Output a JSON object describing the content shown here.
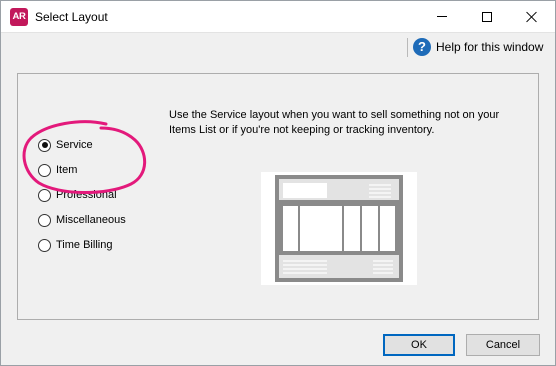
{
  "window": {
    "app_icon_text": "AR",
    "title": "Select Layout",
    "controls": [
      "minimize-icon",
      "maximize-icon",
      "close-icon"
    ]
  },
  "toolbar": {
    "help_icon": "help-icon",
    "help_label": "Help for this window"
  },
  "layout_options": [
    {
      "label": "Service",
      "selected": true
    },
    {
      "label": "Item",
      "selected": false
    },
    {
      "label": "Professional",
      "selected": false
    },
    {
      "label": "Miscellaneous",
      "selected": false
    },
    {
      "label": "Time Billing",
      "selected": false
    }
  ],
  "description": "Use the Service layout when you want to sell something not on your Items List or if you're not keeping or tracking inventory.",
  "buttons": {
    "ok_label": "OK",
    "cancel_label": "Cancel"
  },
  "colors": {
    "annotation_ring": "#e3197b",
    "app_icon": "#c2185b",
    "help_icon": "#1e6bb8",
    "default_button_border": "#0067c0"
  }
}
